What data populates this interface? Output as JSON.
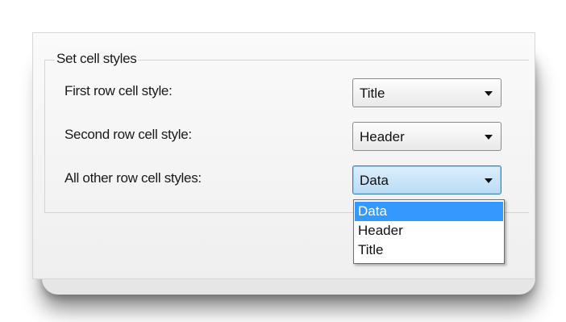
{
  "group": {
    "title": "Set cell styles"
  },
  "rows": [
    {
      "label": "First row cell style:",
      "value": "Title"
    },
    {
      "label": "Second row cell style:",
      "value": "Header"
    },
    {
      "label": "All other row cell styles:",
      "value": "Data"
    }
  ],
  "dropdown": {
    "options": [
      "Data",
      "Header",
      "Title"
    ],
    "selected": "Data"
  },
  "icons": {
    "combo_arrow": "chevron-down-icon"
  },
  "colors": {
    "selection_bg": "#3399ff",
    "active_combo_border": "#3c7fb1"
  }
}
